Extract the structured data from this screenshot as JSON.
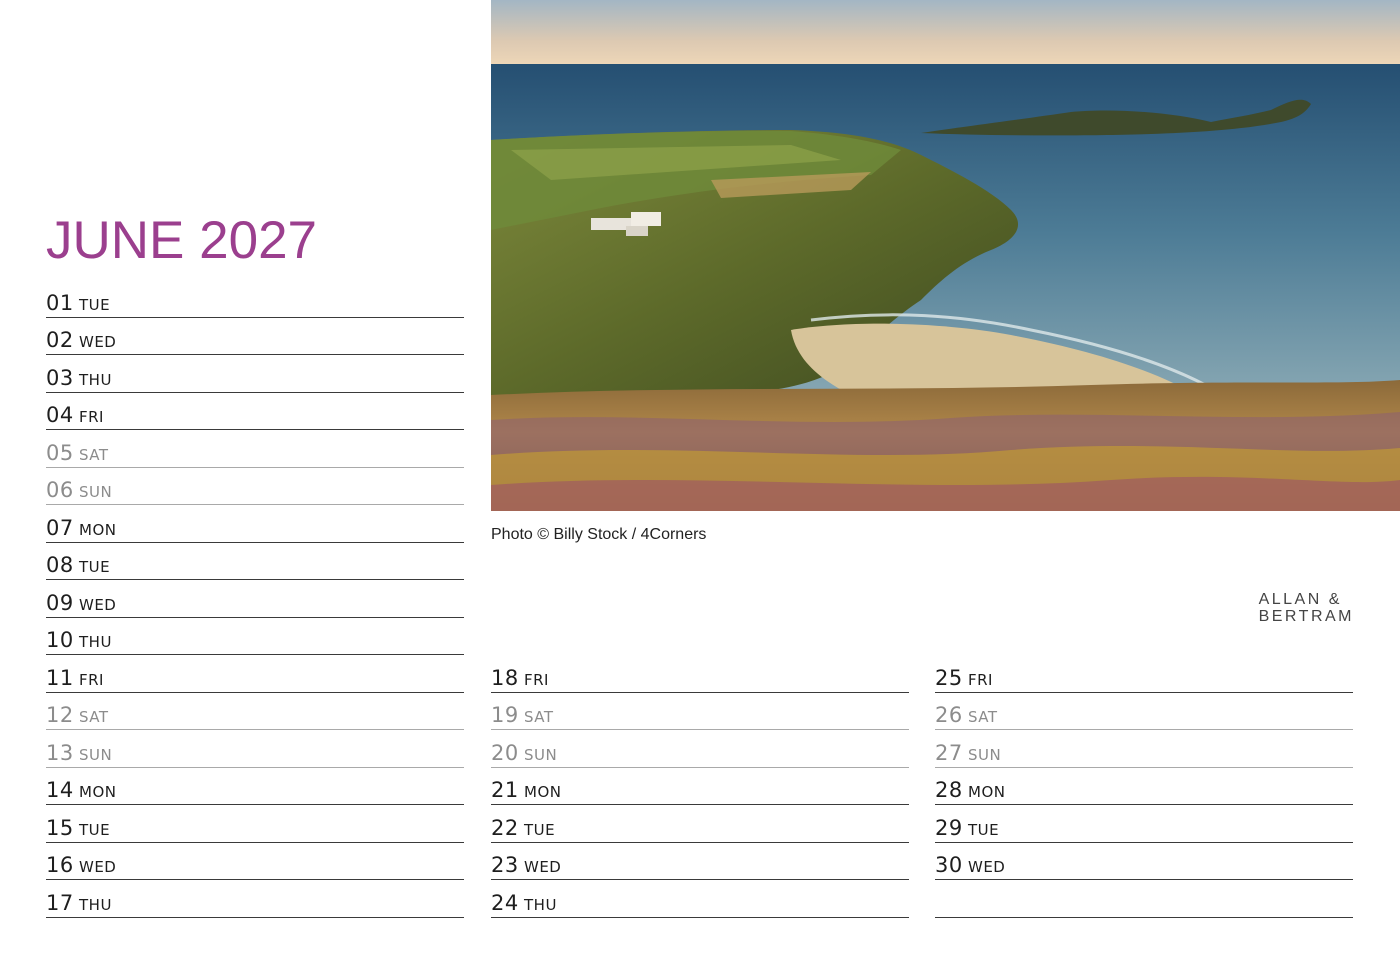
{
  "header": {
    "title": "JUNE 2027"
  },
  "photo": {
    "credit": "Photo © Billy Stock / 4Corners"
  },
  "brand": {
    "line1": "ALLAN &",
    "line2": "BERTRAM"
  },
  "columns": [
    [
      {
        "num": "01",
        "dow": "TUE",
        "weekend": false
      },
      {
        "num": "02",
        "dow": "WED",
        "weekend": false
      },
      {
        "num": "03",
        "dow": "THU",
        "weekend": false
      },
      {
        "num": "04",
        "dow": "FRI",
        "weekend": false
      },
      {
        "num": "05",
        "dow": "SAT",
        "weekend": true
      },
      {
        "num": "06",
        "dow": "SUN",
        "weekend": true
      },
      {
        "num": "07",
        "dow": "MON",
        "weekend": false
      },
      {
        "num": "08",
        "dow": "TUE",
        "weekend": false
      },
      {
        "num": "09",
        "dow": "WED",
        "weekend": false
      },
      {
        "num": "10",
        "dow": "THU",
        "weekend": false
      },
      {
        "num": "11",
        "dow": "FRI",
        "weekend": false
      },
      {
        "num": "12",
        "dow": "SAT",
        "weekend": true
      },
      {
        "num": "13",
        "dow": "SUN",
        "weekend": true
      },
      {
        "num": "14",
        "dow": "MON",
        "weekend": false
      },
      {
        "num": "15",
        "dow": "TUE",
        "weekend": false
      },
      {
        "num": "16",
        "dow": "WED",
        "weekend": false
      },
      {
        "num": "17",
        "dow": "THU",
        "weekend": false
      }
    ],
    [
      {
        "num": "18",
        "dow": "FRI",
        "weekend": false
      },
      {
        "num": "19",
        "dow": "SAT",
        "weekend": true
      },
      {
        "num": "20",
        "dow": "SUN",
        "weekend": true
      },
      {
        "num": "21",
        "dow": "MON",
        "weekend": false
      },
      {
        "num": "22",
        "dow": "TUE",
        "weekend": false
      },
      {
        "num": "23",
        "dow": "WED",
        "weekend": false
      },
      {
        "num": "24",
        "dow": "THU",
        "weekend": false
      }
    ],
    [
      {
        "num": "25",
        "dow": "FRI",
        "weekend": false
      },
      {
        "num": "26",
        "dow": "SAT",
        "weekend": true
      },
      {
        "num": "27",
        "dow": "SUN",
        "weekend": true
      },
      {
        "num": "28",
        "dow": "MON",
        "weekend": false
      },
      {
        "num": "29",
        "dow": "TUE",
        "weekend": false
      },
      {
        "num": "30",
        "dow": "WED",
        "weekend": false
      },
      {
        "num": "",
        "dow": "",
        "weekend": false
      }
    ]
  ]
}
